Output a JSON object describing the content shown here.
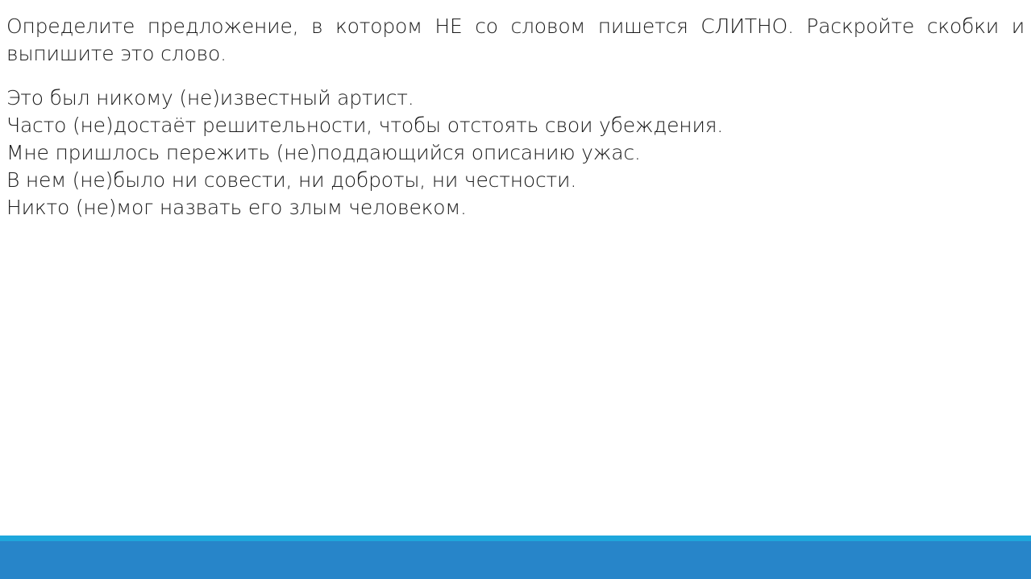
{
  "task": {
    "text": "Определите предложение, в котором НЕ со словом пишется СЛИТНО. Раскройте скобки и выпишите это слово."
  },
  "sentences": [
    "Это был никому (не)известный артист.",
    "Часто (не)достаёт решительности, чтобы отстоять свои убеждения.",
    "Мне пришлось пережить (не)поддающийся описанию ужас.",
    "В нем (не)было ни совести, ни доброты, ни честности.",
    "Никто (не)мог назвать его злым человеком."
  ],
  "colors": {
    "footer_stripe": "#1ea7dc",
    "footer_bar": "#2785c9"
  }
}
